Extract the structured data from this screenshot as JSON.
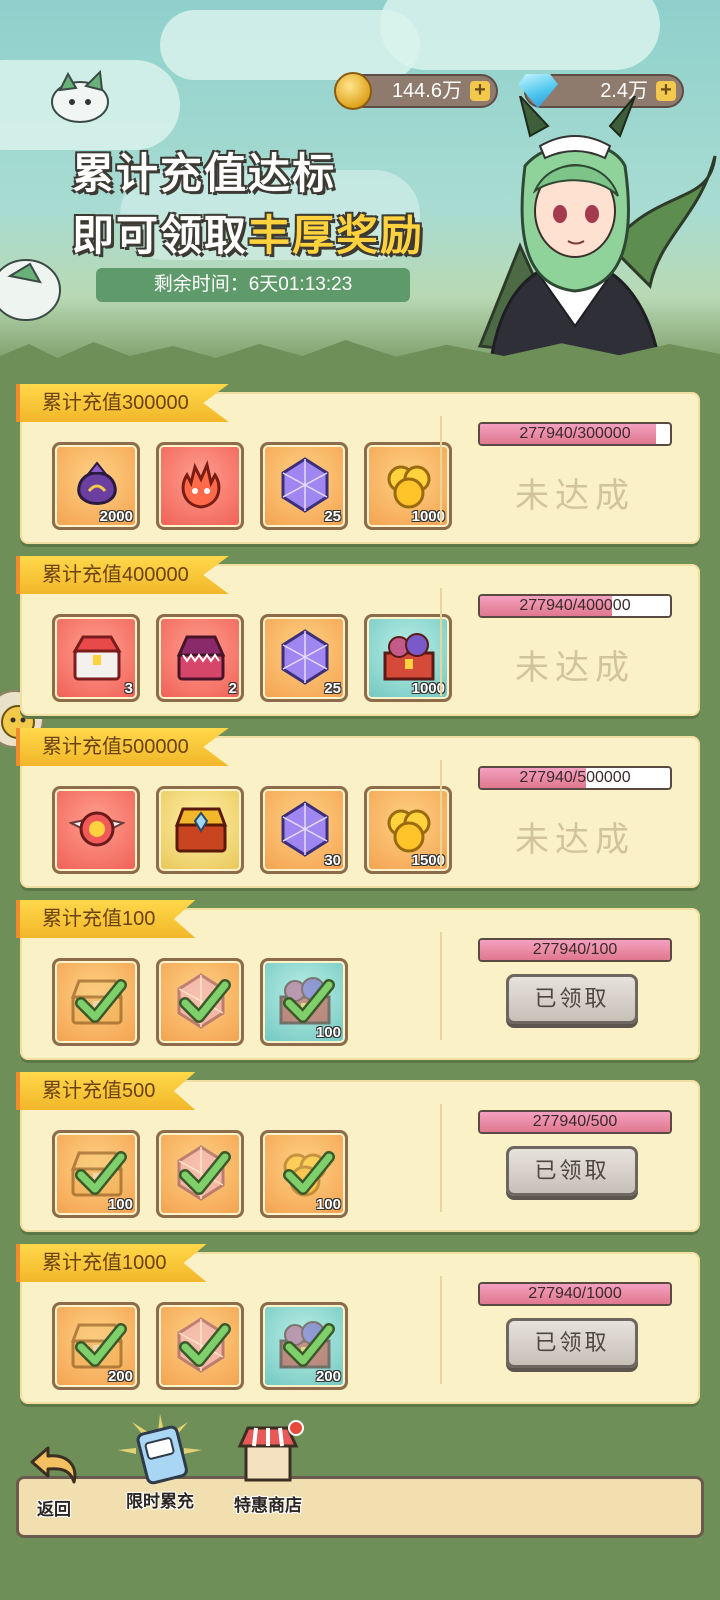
{
  "resources": {
    "gold": {
      "value": "144.6万",
      "plus": "+"
    },
    "diamond": {
      "value": "2.4万",
      "plus": "+"
    }
  },
  "banner": {
    "line1": "累计充值达标",
    "line2_normal": "即可领取",
    "line2_highlight": "丰厚奖励",
    "timer": "剩余时间：6天01:13:23"
  },
  "tiers": [
    {
      "title": "累计充值300000",
      "progress_text": "277940/300000",
      "progress_fraction": 0.9265,
      "status": "未达成",
      "claimed": false,
      "rewards": [
        {
          "icon": "coin-bag-icon",
          "qty": "2000"
        },
        {
          "icon": "flame-pet-icon",
          "qty": ""
        },
        {
          "icon": "purple-crystal-icon",
          "qty": "25"
        },
        {
          "icon": "gold-ore-icon",
          "qty": "1000"
        }
      ]
    },
    {
      "title": "累计充值400000",
      "progress_text": "277940/400000",
      "progress_fraction": 0.6949,
      "status": "未达成",
      "claimed": false,
      "rewards": [
        {
          "icon": "ssr-chest-icon",
          "qty": "3"
        },
        {
          "icon": "mimic-chest-icon",
          "qty": "2"
        },
        {
          "icon": "purple-crystal-icon",
          "qty": "25"
        },
        {
          "icon": "treasure-box-icon",
          "qty": "1000"
        }
      ]
    },
    {
      "title": "累计充值500000",
      "progress_text": "277940/500000",
      "progress_fraction": 0.5559,
      "status": "未达成",
      "claimed": false,
      "rewards": [
        {
          "icon": "winged-emblem-icon",
          "qty": ""
        },
        {
          "icon": "golden-chest-icon",
          "qty": ""
        },
        {
          "icon": "purple-crystal-icon",
          "qty": "30"
        },
        {
          "icon": "gold-ore-icon",
          "qty": "1500"
        }
      ]
    },
    {
      "title": "累计充值100",
      "progress_text": "277940/100",
      "progress_fraction": 1,
      "status": "已领取",
      "claimed": true,
      "rewards": [
        {
          "icon": "chest-icon",
          "qty": ""
        },
        {
          "icon": "pink-crystal-icon",
          "qty": ""
        },
        {
          "icon": "treasure-box-icon",
          "qty": "100"
        }
      ]
    },
    {
      "title": "累计充值500",
      "progress_text": "277940/500",
      "progress_fraction": 1,
      "status": "已领取",
      "claimed": true,
      "rewards": [
        {
          "icon": "chest-icon",
          "qty": "100"
        },
        {
          "icon": "pink-crystal-icon",
          "qty": ""
        },
        {
          "icon": "gold-ore-icon",
          "qty": "100"
        }
      ]
    },
    {
      "title": "累计充值1000",
      "progress_text": "277940/1000",
      "progress_fraction": 1,
      "status": "已领取",
      "claimed": true,
      "rewards": [
        {
          "icon": "chest-icon",
          "qty": "200"
        },
        {
          "icon": "pink-crystal-icon",
          "qty": ""
        },
        {
          "icon": "treasure-box-icon",
          "qty": "200"
        }
      ]
    }
  ],
  "nav": {
    "back": "返回",
    "limited_recharge": "限时累充",
    "special_shop": "特惠商店"
  }
}
